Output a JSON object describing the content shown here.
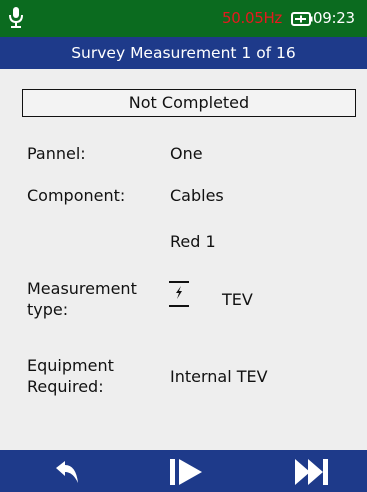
{
  "status_bar": {
    "frequency": "50.05Hz",
    "time": "09:23",
    "icons": [
      "microphone-icon",
      "battery-icon"
    ],
    "colors": {
      "background": "#0b6b1f",
      "frequency": "#e5191e"
    }
  },
  "title": "Survey Measurement 1 of 16",
  "completion_status": "Not Completed",
  "fields": {
    "panel": {
      "label": "Pannel:",
      "value": "One"
    },
    "component": {
      "label": "Component:",
      "value": "Cables",
      "detail": "Red 1"
    },
    "measurement_type": {
      "label_line1": "Measurement",
      "label_line2": "type:",
      "value": "TEV",
      "icon": "tev-icon"
    },
    "equipment": {
      "label_line1": "Equipment",
      "label_line2": "Required:",
      "value": "Internal TEV"
    }
  },
  "toolbar": {
    "icons": [
      "back-arrow-icon",
      "play-step-icon",
      "skip-forward-icon"
    ],
    "colors": {
      "background": "#1e3a8a"
    }
  }
}
